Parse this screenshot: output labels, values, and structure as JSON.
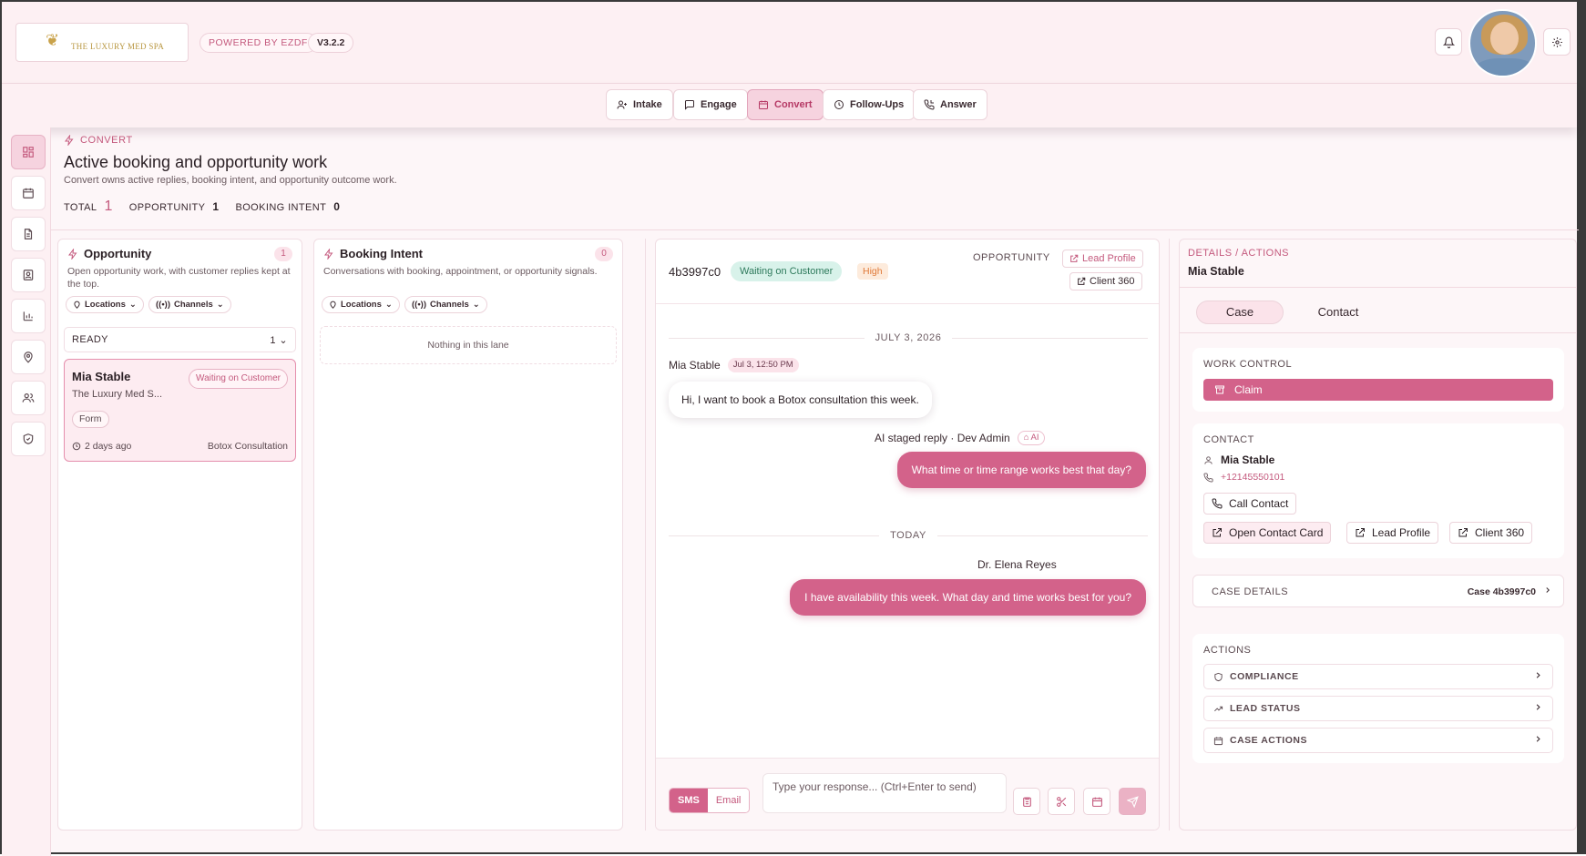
{
  "header": {
    "logo_text": "THE LUXURY MED SPA",
    "powered": "POWERED BY EZDF",
    "version": "V3.2.2"
  },
  "nav": [
    {
      "label": "Intake",
      "icon": "user-plus-icon"
    },
    {
      "label": "Engage",
      "icon": "message-square-icon"
    },
    {
      "label": "Convert",
      "icon": "calendar-icon",
      "active": true
    },
    {
      "label": "Follow-Ups",
      "icon": "clock-icon"
    },
    {
      "label": "Answer",
      "icon": "phone-incoming-icon"
    }
  ],
  "page": {
    "section": "CONVERT",
    "title": "Active booking and opportunity work",
    "subtitle": "Convert owns active replies, booking intent, and opportunity outcome work.",
    "stats": {
      "total_label": "TOTAL",
      "total": "1",
      "opp_label": "OPPORTUNITY",
      "opp": "1",
      "intent_label": "BOOKING INTENT",
      "intent": "0"
    }
  },
  "lanes": {
    "opportunity": {
      "title": "Opportunity",
      "count": "1",
      "desc": "Open opportunity work, with customer replies kept at the top.",
      "filters": [
        "Locations",
        "Channels"
      ],
      "group_label": "READY",
      "group_count": "1",
      "card": {
        "name": "Mia Stable",
        "org": "The Luxury Med S...",
        "status": "Waiting on Customer",
        "tag": "Form",
        "time": "2 days ago",
        "service": "Botox Consultation"
      }
    },
    "intent": {
      "title": "Booking Intent",
      "count": "0",
      "desc": "Conversations with booking, appointment, or opportunity signals.",
      "filters": [
        "Locations",
        "Channels"
      ],
      "empty": "Nothing in this lane"
    }
  },
  "conversation": {
    "id": "4b3997c0",
    "status": "Waiting on Customer",
    "priority": "High",
    "type_label": "OPPORTUNITY",
    "lead_profile": "Lead Profile",
    "client_360": "Client 360",
    "date1": "JULY 3, 2026",
    "msg1_sender": "Mia Stable",
    "msg1_time": "Jul 3, 12:50 PM",
    "msg1_text": "Hi, I want to book a Botox consultation this week.",
    "msg2_meta": "AI staged reply · Dev Admin",
    "msg2_chip": "AI",
    "msg2_text": "What time or time range works best that day?",
    "date2": "TODAY",
    "msg3_sender": "Dr. Elena Reyes",
    "msg3_text": "I have availability this week. What day and time works best for you?",
    "composer": {
      "sms": "SMS",
      "email": "Email",
      "placeholder": "Type your response... (Ctrl+Enter to send)"
    }
  },
  "details": {
    "tag": "DETAILS / ACTIONS",
    "name": "Mia Stable",
    "tabs": [
      "Case",
      "Contact"
    ],
    "work_control": "WORK CONTROL",
    "claim": "Claim",
    "contact_title": "CONTACT",
    "contact_name": "Mia Stable",
    "contact_phone": "+12145550101",
    "call": "Call Contact",
    "open_card": "Open Contact Card",
    "lead_profile": "Lead Profile",
    "client_360": "Client 360",
    "case_details": "CASE DETAILS",
    "case_value": "Case 4b3997c0",
    "actions_title": "ACTIONS",
    "actions": [
      "COMPLIANCE",
      "LEAD STATUS",
      "CASE ACTIONS"
    ]
  },
  "colors": {
    "accent": "#d3628a",
    "accent_text": "#c4597d",
    "success_bg": "#d8f2ea",
    "warning_text": "#e07a3a"
  }
}
